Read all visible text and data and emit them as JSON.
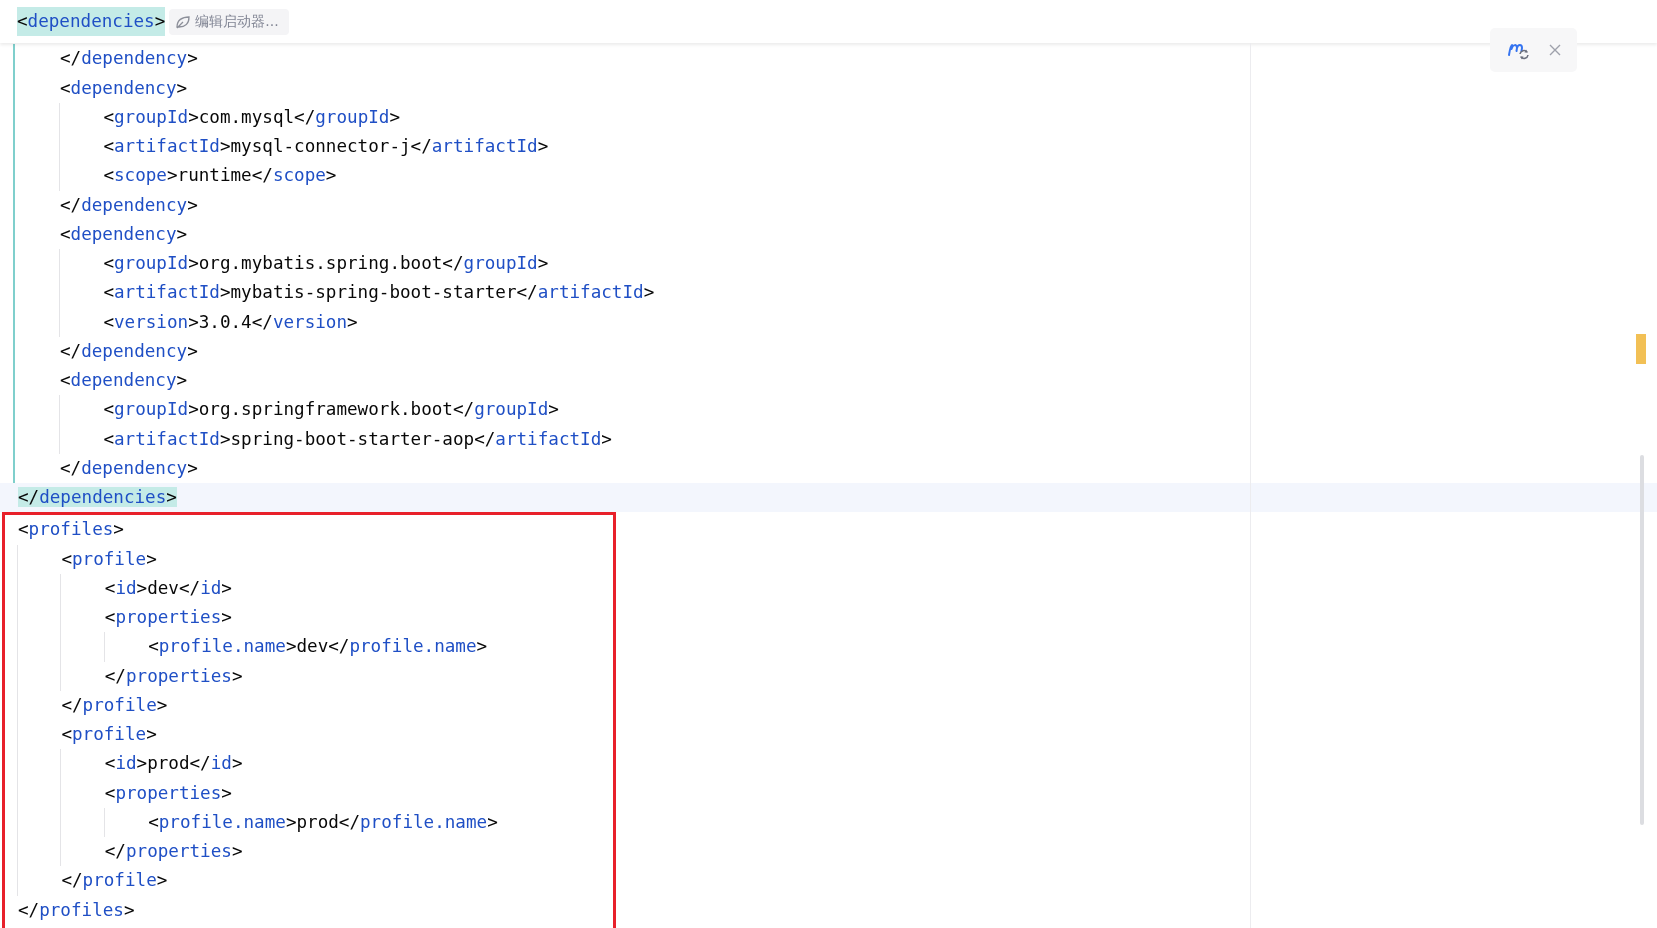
{
  "sticky_header": {
    "text": "<dependencies>",
    "highlighted": true
  },
  "hint": {
    "label": "编辑启动器..."
  },
  "code": [
    {
      "kind": "scope",
      "children": [
        {
          "kind": "line",
          "text": "</dependency>",
          "highlighted": false
        },
        {
          "kind": "line",
          "text": "<dependency>",
          "highlighted": false,
          "children": [
            {
              "kind": "line",
              "text": "<groupId>com.mysql</groupId>",
              "highlighted": false
            },
            {
              "kind": "line",
              "text": "<artifactId>mysql-connector-j</artifactId>",
              "highlighted": false
            },
            {
              "kind": "line",
              "text": "<scope>runtime</scope>",
              "highlighted": false
            }
          ]
        },
        {
          "kind": "line",
          "text": "</dependency>",
          "highlighted": false
        },
        {
          "kind": "line",
          "text": "<dependency>",
          "highlighted": false,
          "children": [
            {
              "kind": "line",
              "text": "<groupId>org.mybatis.spring.boot</groupId>",
              "highlighted": false
            },
            {
              "kind": "line",
              "text": "<artifactId>mybatis-spring-boot-starter</artifactId>",
              "highlighted": false
            },
            {
              "kind": "line",
              "text": "<version>3.0.4</version>",
              "highlighted": false
            }
          ]
        },
        {
          "kind": "line",
          "text": "</dependency>",
          "highlighted": false
        },
        {
          "kind": "line",
          "text": "<dependency>",
          "highlighted": false,
          "children": [
            {
              "kind": "line",
              "text": "<groupId>org.springframework.boot</groupId>",
              "highlighted": false
            },
            {
              "kind": "line",
              "text": "<artifactId>spring-boot-starter-aop</artifactId>",
              "highlighted": false
            }
          ]
        },
        {
          "kind": "line",
          "text": "</dependency>",
          "highlighted": false
        }
      ]
    },
    {
      "kind": "line",
      "text": "</dependencies>",
      "highlighted": true
    },
    {
      "kind": "annotated",
      "children": [
        {
          "kind": "line",
          "text": "<profiles>",
          "highlighted": false,
          "children": [
            {
              "kind": "line",
              "text": "<profile>",
              "highlighted": false,
              "children": [
                {
                  "kind": "line",
                  "text": "<id>dev</id>",
                  "highlighted": false
                },
                {
                  "kind": "line",
                  "text": "<properties>",
                  "highlighted": false,
                  "children": [
                    {
                      "kind": "line",
                      "text": "<profile.name>dev</profile.name>",
                      "highlighted": false
                    }
                  ]
                },
                {
                  "kind": "line",
                  "text": "</properties>",
                  "highlighted": false
                }
              ]
            },
            {
              "kind": "line",
              "text": "</profile>",
              "highlighted": false
            },
            {
              "kind": "line",
              "text": "<profile>",
              "highlighted": false,
              "children": [
                {
                  "kind": "line",
                  "text": "<id>prod</id>",
                  "highlighted": false
                },
                {
                  "kind": "line",
                  "text": "<properties>",
                  "highlighted": false,
                  "children": [
                    {
                      "kind": "line",
                      "text": "<profile.name>prod</profile.name>",
                      "highlighted": false
                    }
                  ]
                },
                {
                  "kind": "line",
                  "text": "</properties>",
                  "highlighted": false
                }
              ]
            },
            {
              "kind": "line",
              "text": "</profile>",
              "highlighted": false
            }
          ]
        },
        {
          "kind": "line",
          "text": "</profiles>",
          "highlighted": false
        }
      ]
    }
  ]
}
